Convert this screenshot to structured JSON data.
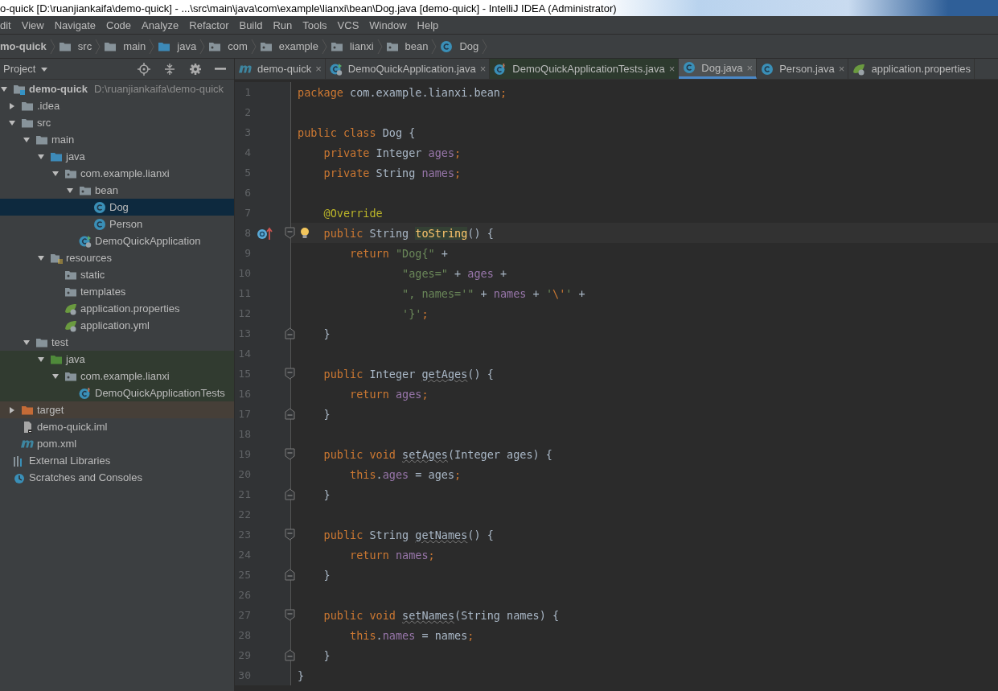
{
  "window": {
    "title": "o-quick [D:\\ruanjiankaifa\\demo-quick] - ...\\src\\main\\java\\com\\example\\lianxi\\bean\\Dog.java [demo-quick] - IntelliJ IDEA (Administrator)"
  },
  "menu": [
    "dit",
    "View",
    "Navigate",
    "Code",
    "Analyze",
    "Refactor",
    "Build",
    "Run",
    "Tools",
    "VCS",
    "Window",
    "Help"
  ],
  "breadcrumb": [
    {
      "label": "mo-quick",
      "kind": "module"
    },
    {
      "label": "src",
      "kind": "folder"
    },
    {
      "label": "main",
      "kind": "folder"
    },
    {
      "label": "java",
      "kind": "source-folder"
    },
    {
      "label": "com",
      "kind": "package"
    },
    {
      "label": "example",
      "kind": "package"
    },
    {
      "label": "lianxi",
      "kind": "package"
    },
    {
      "label": "bean",
      "kind": "package"
    },
    {
      "label": "Dog",
      "kind": "class"
    }
  ],
  "project_panel": {
    "title": "Project",
    "tree": [
      {
        "label": "demo-quick",
        "path": "D:\\ruanjiankaifa\\demo-quick",
        "kind": "module",
        "expanded": true,
        "selected": false,
        "children": [
          {
            "label": ".idea",
            "kind": "folder",
            "expanded": false,
            "selected": false
          },
          {
            "label": "src",
            "kind": "folder",
            "expanded": true,
            "selected": false,
            "children": [
              {
                "label": "main",
                "kind": "folder",
                "expanded": true,
                "selected": false,
                "children": [
                  {
                    "label": "java",
                    "kind": "source-folder",
                    "expanded": true,
                    "selected": false,
                    "children": [
                      {
                        "label": "com.example.lianxi",
                        "kind": "package",
                        "expanded": true,
                        "selected": false,
                        "children": [
                          {
                            "label": "bean",
                            "kind": "package",
                            "expanded": true,
                            "selected": false,
                            "children": [
                              {
                                "label": "Dog",
                                "kind": "class",
                                "selected": true
                              },
                              {
                                "label": "Person",
                                "kind": "class",
                                "selected": false
                              }
                            ]
                          },
                          {
                            "label": "DemoQuickApplication",
                            "kind": "spring-class",
                            "selected": false
                          }
                        ]
                      }
                    ]
                  },
                  {
                    "label": "resources",
                    "kind": "resources-folder",
                    "expanded": true,
                    "selected": false,
                    "children": [
                      {
                        "label": "static",
                        "kind": "package",
                        "selected": false
                      },
                      {
                        "label": "templates",
                        "kind": "package",
                        "selected": false
                      },
                      {
                        "label": "application.properties",
                        "kind": "spring-config",
                        "selected": false
                      },
                      {
                        "label": "application.yml",
                        "kind": "spring-config",
                        "selected": false
                      }
                    ]
                  }
                ]
              },
              {
                "label": "test",
                "kind": "folder",
                "expanded": true,
                "selected": false,
                "children": [
                  {
                    "label": "java",
                    "kind": "test-folder",
                    "test_source": true,
                    "expanded": true,
                    "selected": false,
                    "children": [
                      {
                        "label": "com.example.lianxi",
                        "kind": "package",
                        "test_source": true,
                        "expanded": true,
                        "selected": false,
                        "children": [
                          {
                            "label": "DemoQuickApplicationTests",
                            "kind": "test-class",
                            "test_source": true,
                            "selected": false
                          }
                        ]
                      }
                    ]
                  }
                ]
              }
            ]
          },
          {
            "label": "target",
            "kind": "excluded-folder",
            "excluded": true,
            "expanded": false,
            "selected": false
          },
          {
            "label": "demo-quick.iml",
            "kind": "iml",
            "selected": false
          },
          {
            "label": "pom.xml",
            "kind": "maven",
            "selected": false
          }
        ]
      },
      {
        "label": "External Libraries",
        "kind": "libraries",
        "selected": false
      },
      {
        "label": "Scratches and Consoles",
        "kind": "scratches",
        "selected": false
      }
    ]
  },
  "tabs": [
    {
      "label": "demo-quick",
      "kind": "maven",
      "close": "×",
      "selected": false
    },
    {
      "label": "DemoQuickApplication.java",
      "kind": "spring-class",
      "close": "×",
      "selected": false
    },
    {
      "label": "DemoQuickApplicationTests.java",
      "kind": "test-class",
      "close": "×",
      "selected": false,
      "test_source": true
    },
    {
      "label": "Dog.java",
      "kind": "class",
      "close": "×",
      "selected": true
    },
    {
      "label": "Person.java",
      "kind": "class",
      "close": "×",
      "selected": false
    },
    {
      "label": "application.properties",
      "kind": "spring-config",
      "selected": false
    }
  ],
  "editor": {
    "lines": [
      {
        "number": "1",
        "tokens": [
          {
            "kind": "kw",
            "text": "package"
          },
          {
            "kind": "plain",
            "text": " com.example.lianxi.bean"
          },
          {
            "kind": "kw",
            "text": ";"
          }
        ]
      },
      {
        "number": "2"
      },
      {
        "number": "3",
        "tokens": [
          {
            "kind": "kw",
            "text": "public class"
          },
          {
            "kind": "plain",
            "text": " Dog {"
          }
        ]
      },
      {
        "number": "4",
        "tokens": [
          {
            "kind": "kw",
            "text": "    private"
          },
          {
            "kind": "plain",
            "text": " Integer "
          },
          {
            "kind": "field",
            "text": "ages"
          },
          {
            "kind": "kw",
            "text": ";"
          }
        ]
      },
      {
        "number": "5",
        "tokens": [
          {
            "kind": "kw",
            "text": "    private"
          },
          {
            "kind": "plain",
            "text": " String "
          },
          {
            "kind": "field",
            "text": "names"
          },
          {
            "kind": "kw",
            "text": ";"
          }
        ]
      },
      {
        "number": "6"
      },
      {
        "number": "7",
        "tokens": [
          {
            "kind": "ann",
            "text": "    @Override"
          }
        ]
      },
      {
        "number": "8",
        "current": true,
        "override": true,
        "bulb": true,
        "fold_start": true,
        "tokens": [
          {
            "kind": "kw",
            "text": "    public"
          },
          {
            "kind": "plain",
            "text": " String "
          },
          {
            "kind": "decl-hl",
            "text": "toString"
          },
          {
            "kind": "plain",
            "text": "() {"
          }
        ]
      },
      {
        "number": "9",
        "tokens": [
          {
            "kind": "kw",
            "text": "        return "
          },
          {
            "kind": "str",
            "text": "\"Dog{\""
          },
          {
            "kind": "plain",
            "text": " +"
          }
        ]
      },
      {
        "number": "10",
        "tokens": [
          {
            "kind": "str",
            "text": "                \"ages=\""
          },
          {
            "kind": "plain",
            "text": " + "
          },
          {
            "kind": "field",
            "text": "ages"
          },
          {
            "kind": "plain",
            "text": " +"
          }
        ]
      },
      {
        "number": "11",
        "tokens": [
          {
            "kind": "str",
            "text": "                \", names='\""
          },
          {
            "kind": "plain",
            "text": " + "
          },
          {
            "kind": "field",
            "text": "names"
          },
          {
            "kind": "plain",
            "text": " + "
          },
          {
            "kind": "str",
            "text": "'"
          },
          {
            "kind": "kw",
            "text": "\\'"
          },
          {
            "kind": "str",
            "text": "'"
          },
          {
            "kind": "plain",
            "text": " +"
          }
        ]
      },
      {
        "number": "12",
        "tokens": [
          {
            "kind": "str",
            "text": "                '}'"
          },
          {
            "kind": "kw",
            "text": ";"
          }
        ]
      },
      {
        "number": "13",
        "fold_end": true,
        "tokens": [
          {
            "kind": "plain",
            "text": "    }"
          }
        ]
      },
      {
        "number": "14"
      },
      {
        "number": "15",
        "fold_start": true,
        "tokens": [
          {
            "kind": "kw",
            "text": "    public"
          },
          {
            "kind": "plain",
            "text": " Integer "
          },
          {
            "kind": "unused",
            "text": "getAges"
          },
          {
            "kind": "plain",
            "text": "() {"
          }
        ]
      },
      {
        "number": "16",
        "tokens": [
          {
            "kind": "kw",
            "text": "        return "
          },
          {
            "kind": "field",
            "text": "ages"
          },
          {
            "kind": "kw",
            "text": ";"
          }
        ]
      },
      {
        "number": "17",
        "fold_end": true,
        "tokens": [
          {
            "kind": "plain",
            "text": "    }"
          }
        ]
      },
      {
        "number": "18"
      },
      {
        "number": "19",
        "fold_start": true,
        "tokens": [
          {
            "kind": "kw",
            "text": "    public void "
          },
          {
            "kind": "unused",
            "text": "setAges"
          },
          {
            "kind": "plain",
            "text": "(Integer ages) {"
          }
        ]
      },
      {
        "number": "20",
        "tokens": [
          {
            "kind": "kw",
            "text": "        this"
          },
          {
            "kind": "plain",
            "text": "."
          },
          {
            "kind": "field",
            "text": "ages"
          },
          {
            "kind": "plain",
            "text": " = ages"
          },
          {
            "kind": "kw",
            "text": ";"
          }
        ]
      },
      {
        "number": "21",
        "fold_end": true,
        "tokens": [
          {
            "kind": "plain",
            "text": "    }"
          }
        ]
      },
      {
        "number": "22"
      },
      {
        "number": "23",
        "fold_start": true,
        "tokens": [
          {
            "kind": "kw",
            "text": "    public"
          },
          {
            "kind": "plain",
            "text": " String "
          },
          {
            "kind": "unused",
            "text": "getNames"
          },
          {
            "kind": "plain",
            "text": "() {"
          }
        ]
      },
      {
        "number": "24",
        "tokens": [
          {
            "kind": "kw",
            "text": "        return "
          },
          {
            "kind": "field",
            "text": "names"
          },
          {
            "kind": "kw",
            "text": ";"
          }
        ]
      },
      {
        "number": "25",
        "fold_end": true,
        "tokens": [
          {
            "kind": "plain",
            "text": "    }"
          }
        ]
      },
      {
        "number": "26"
      },
      {
        "number": "27",
        "fold_start": true,
        "tokens": [
          {
            "kind": "kw",
            "text": "    public void "
          },
          {
            "kind": "unused",
            "text": "setNames"
          },
          {
            "kind": "plain",
            "text": "(String names) {"
          }
        ]
      },
      {
        "number": "28",
        "tokens": [
          {
            "kind": "kw",
            "text": "        this"
          },
          {
            "kind": "plain",
            "text": "."
          },
          {
            "kind": "field",
            "text": "names"
          },
          {
            "kind": "plain",
            "text": " = names"
          },
          {
            "kind": "kw",
            "text": ";"
          }
        ]
      },
      {
        "number": "29",
        "fold_end": true,
        "tokens": [
          {
            "kind": "plain",
            "text": "    }"
          }
        ]
      },
      {
        "number": "30",
        "tokens": [
          {
            "kind": "plain",
            "text": "}"
          }
        ]
      }
    ]
  }
}
